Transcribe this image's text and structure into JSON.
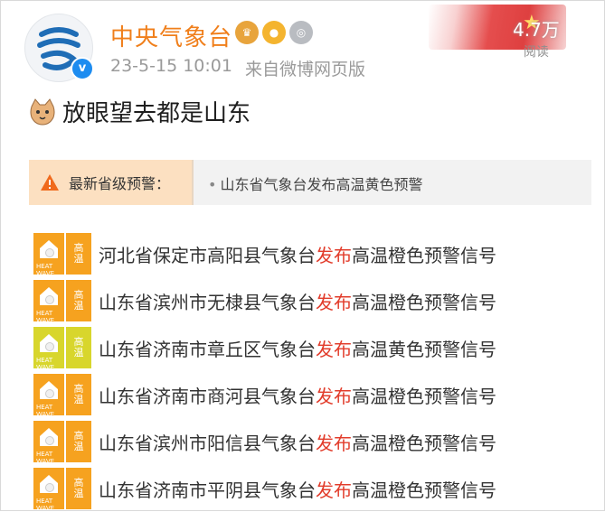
{
  "account": {
    "name": "中央气象台",
    "date": "23-5-15 10:01",
    "source": "来自微博网页版",
    "avatar_glyph": "气",
    "verified_mark": "v",
    "badges": [
      "medal-icon",
      "fan-icon",
      "level-icon"
    ]
  },
  "banner": {
    "reads_number": "4.7万",
    "reads_label": "阅读"
  },
  "post": {
    "text": "放眼望去都是山东"
  },
  "alert": {
    "title": "最新省级预警：",
    "text": "山东省气象台发布高温黄色预警"
  },
  "tile": {
    "top": "高",
    "bottom": "温",
    "caption": "HEAT WAVE"
  },
  "warnings": [
    {
      "prefix": "河北省保定市高阳县气象台",
      "verb": "发布",
      "suffix": "高温橙色预警信号",
      "color": "#f6a21f"
    },
    {
      "prefix": "山东省滨州市无棣县气象台",
      "verb": "发布",
      "suffix": "高温橙色预警信号",
      "color": "#f6a21f"
    },
    {
      "prefix": "山东省济南市章丘区气象台",
      "verb": "发布",
      "suffix": "高温黄色预警信号",
      "color": "#d8d62c"
    },
    {
      "prefix": "山东省济南市商河县气象台",
      "verb": "发布",
      "suffix": "高温橙色预警信号",
      "color": "#f6a21f"
    },
    {
      "prefix": "山东省滨州市阳信县气象台",
      "verb": "发布",
      "suffix": "高温橙色预警信号",
      "color": "#f6a21f"
    },
    {
      "prefix": "山东省济南市平阴县气象台",
      "verb": "发布",
      "suffix": "高温橙色预警信号",
      "color": "#f6a21f"
    }
  ]
}
